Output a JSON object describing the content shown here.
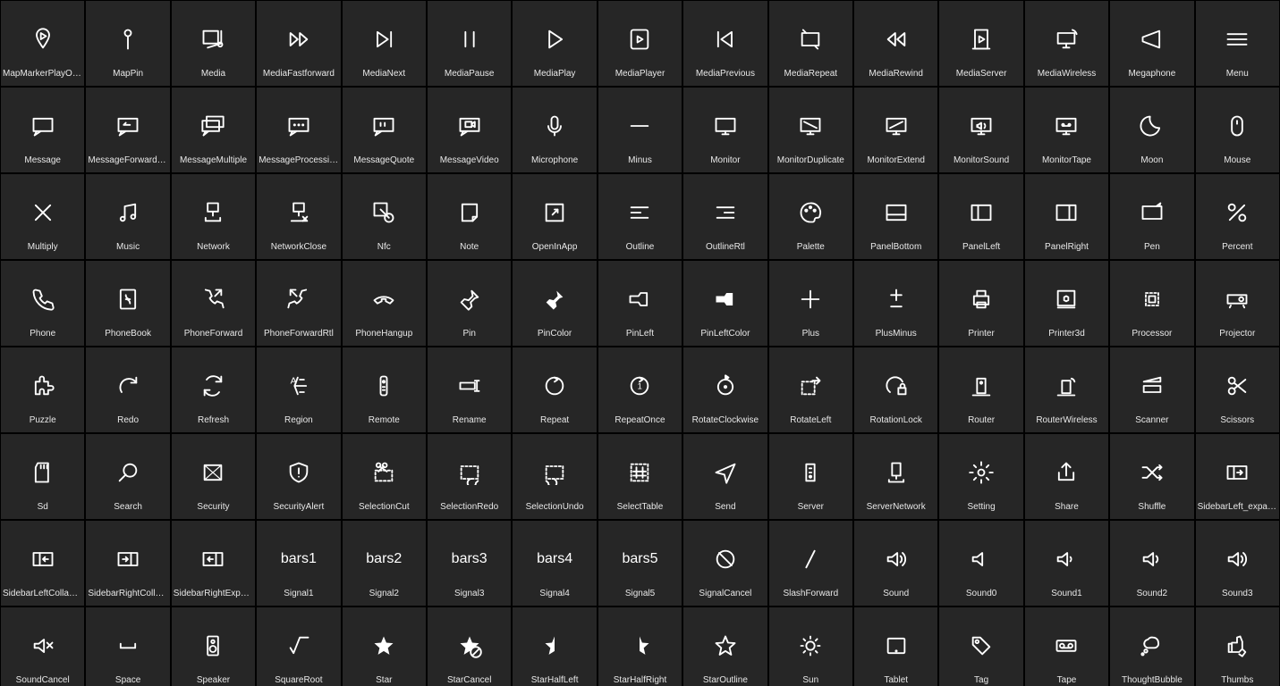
{
  "icons": [
    {
      "name": "MapMarkerPlayOutline",
      "svg": "pin-play"
    },
    {
      "name": "MapPin",
      "svg": "map-pin"
    },
    {
      "name": "Media",
      "svg": "media"
    },
    {
      "name": "MediaFastforward",
      "svg": "ff"
    },
    {
      "name": "MediaNext",
      "svg": "next"
    },
    {
      "name": "MediaPause",
      "svg": "pause"
    },
    {
      "name": "MediaPlay",
      "svg": "play"
    },
    {
      "name": "MediaPlayer",
      "svg": "player"
    },
    {
      "name": "MediaPrevious",
      "svg": "prev"
    },
    {
      "name": "MediaRepeat",
      "svg": "repeat-sq"
    },
    {
      "name": "MediaRewind",
      "svg": "rw"
    },
    {
      "name": "MediaServer",
      "svg": "media-server"
    },
    {
      "name": "MediaWireless",
      "svg": "media-wireless"
    },
    {
      "name": "Megaphone",
      "svg": "megaphone"
    },
    {
      "name": "Menu",
      "svg": "menu"
    },
    {
      "name": "Message",
      "svg": "msg"
    },
    {
      "name": "MessageForwardRtl",
      "svg": "msg-fwd"
    },
    {
      "name": "MessageMultiple",
      "svg": "msg-multi"
    },
    {
      "name": "MessageProcessing",
      "svg": "msg-dots"
    },
    {
      "name": "MessageQuote",
      "svg": "msg-quote"
    },
    {
      "name": "MessageVideo",
      "svg": "msg-video"
    },
    {
      "name": "Microphone",
      "svg": "mic"
    },
    {
      "name": "Minus",
      "svg": "minus"
    },
    {
      "name": "Monitor",
      "svg": "monitor"
    },
    {
      "name": "MonitorDuplicate",
      "svg": "monitor-dup"
    },
    {
      "name": "MonitorExtend",
      "svg": "monitor-ext"
    },
    {
      "name": "MonitorSound",
      "svg": "monitor-sound"
    },
    {
      "name": "MonitorTape",
      "svg": "monitor-tape"
    },
    {
      "name": "Moon",
      "svg": "moon"
    },
    {
      "name": "Mouse",
      "svg": "mouse"
    },
    {
      "name": "Multiply",
      "svg": "multiply"
    },
    {
      "name": "Music",
      "svg": "music"
    },
    {
      "name": "Network",
      "svg": "network"
    },
    {
      "name": "NetworkClose",
      "svg": "network-x"
    },
    {
      "name": "Nfc",
      "svg": "nfc"
    },
    {
      "name": "Note",
      "svg": "note"
    },
    {
      "name": "OpenInApp",
      "svg": "open-in"
    },
    {
      "name": "Outline",
      "svg": "outline"
    },
    {
      "name": "OutlineRtl",
      "svg": "outline-rtl"
    },
    {
      "name": "Palette",
      "svg": "palette"
    },
    {
      "name": "PanelBottom",
      "svg": "panel-b"
    },
    {
      "name": "PanelLeft",
      "svg": "panel-l"
    },
    {
      "name": "PanelRight",
      "svg": "panel-r"
    },
    {
      "name": "Pen",
      "svg": "pen"
    },
    {
      "name": "Percent",
      "svg": "percent"
    },
    {
      "name": "Phone",
      "svg": "phone"
    },
    {
      "name": "PhoneBook",
      "svg": "phonebook"
    },
    {
      "name": "PhoneForward",
      "svg": "phone-fwd"
    },
    {
      "name": "PhoneForwardRtl",
      "svg": "phone-fwd-rtl"
    },
    {
      "name": "PhoneHangup",
      "svg": "phone-hang"
    },
    {
      "name": "Pin",
      "svg": "pin"
    },
    {
      "name": "PinColor",
      "svg": "pin-color"
    },
    {
      "name": "PinLeft",
      "svg": "pin-left"
    },
    {
      "name": "PinLeftColor",
      "svg": "pin-left-color"
    },
    {
      "name": "Plus",
      "svg": "plus"
    },
    {
      "name": "PlusMinus",
      "svg": "plusminus"
    },
    {
      "name": "Printer",
      "svg": "printer"
    },
    {
      "name": "Printer3d",
      "svg": "printer3d"
    },
    {
      "name": "Processor",
      "svg": "cpu"
    },
    {
      "name": "Projector",
      "svg": "projector"
    },
    {
      "name": "Puzzle",
      "svg": "puzzle"
    },
    {
      "name": "Redo",
      "svg": "redo"
    },
    {
      "name": "Refresh",
      "svg": "refresh"
    },
    {
      "name": "Region",
      "svg": "region"
    },
    {
      "name": "Remote",
      "svg": "remote"
    },
    {
      "name": "Rename",
      "svg": "rename"
    },
    {
      "name": "Repeat",
      "svg": "repeat"
    },
    {
      "name": "RepeatOnce",
      "svg": "repeat1"
    },
    {
      "name": "RotateClockwise",
      "svg": "rotate-cw"
    },
    {
      "name": "RotateLeft",
      "svg": "rotate-l"
    },
    {
      "name": "RotationLock",
      "svg": "rot-lock"
    },
    {
      "name": "Router",
      "svg": "router"
    },
    {
      "name": "RouterWireless",
      "svg": "router-w"
    },
    {
      "name": "Scanner",
      "svg": "scanner"
    },
    {
      "name": "Scissors",
      "svg": "scissors"
    },
    {
      "name": "Sd",
      "svg": "sd"
    },
    {
      "name": "Search",
      "svg": "search"
    },
    {
      "name": "Security",
      "svg": "security"
    },
    {
      "name": "SecurityAlert",
      "svg": "sec-alert"
    },
    {
      "name": "SelectionCut",
      "svg": "sel-cut"
    },
    {
      "name": "SelectionRedo",
      "svg": "sel-redo"
    },
    {
      "name": "SelectionUndo",
      "svg": "sel-undo"
    },
    {
      "name": "SelectTable",
      "svg": "sel-table"
    },
    {
      "name": "Send",
      "svg": "send"
    },
    {
      "name": "Server",
      "svg": "server"
    },
    {
      "name": "ServerNetwork",
      "svg": "server-net"
    },
    {
      "name": "Setting",
      "svg": "gear"
    },
    {
      "name": "Share",
      "svg": "share"
    },
    {
      "name": "Shuffle",
      "svg": "shuffle"
    },
    {
      "name": "SidebarLeft_expand",
      "svg": "sb-l-exp"
    },
    {
      "name": "SidebarLeftCollapse",
      "svg": "sb-l-col"
    },
    {
      "name": "SidebarRightCollapse",
      "svg": "sb-r-col"
    },
    {
      "name": "SidebarRightExpand",
      "svg": "sb-r-exp"
    },
    {
      "name": "Signal1",
      "svg": "sig1"
    },
    {
      "name": "Signal2",
      "svg": "sig2"
    },
    {
      "name": "Signal3",
      "svg": "sig3"
    },
    {
      "name": "Signal4",
      "svg": "sig4"
    },
    {
      "name": "Signal5",
      "svg": "sig5"
    },
    {
      "name": "SignalCancel",
      "svg": "sig-cancel"
    },
    {
      "name": "SlashForward",
      "svg": "slash"
    },
    {
      "name": "Sound",
      "svg": "sound"
    },
    {
      "name": "Sound0",
      "svg": "sound0"
    },
    {
      "name": "Sound1",
      "svg": "sound1"
    },
    {
      "name": "Sound2",
      "svg": "sound2"
    },
    {
      "name": "Sound3",
      "svg": "sound3"
    },
    {
      "name": "SoundCancel",
      "svg": "sound-x"
    },
    {
      "name": "Space",
      "svg": "space"
    },
    {
      "name": "Speaker",
      "svg": "speaker"
    },
    {
      "name": "SquareRoot",
      "svg": "sqrt"
    },
    {
      "name": "Star",
      "svg": "star"
    },
    {
      "name": "StarCancel",
      "svg": "star-x"
    },
    {
      "name": "StarHalfLeft",
      "svg": "star-hl"
    },
    {
      "name": "StarHalfRight",
      "svg": "star-hr"
    },
    {
      "name": "StarOutline",
      "svg": "star-o"
    },
    {
      "name": "Sun",
      "svg": "sun"
    },
    {
      "name": "Tablet",
      "svg": "tablet"
    },
    {
      "name": "Tag",
      "svg": "tag"
    },
    {
      "name": "Tape",
      "svg": "tape"
    },
    {
      "name": "ThoughtBubble",
      "svg": "thought"
    },
    {
      "name": "Thumbs",
      "svg": "thumbs"
    }
  ]
}
